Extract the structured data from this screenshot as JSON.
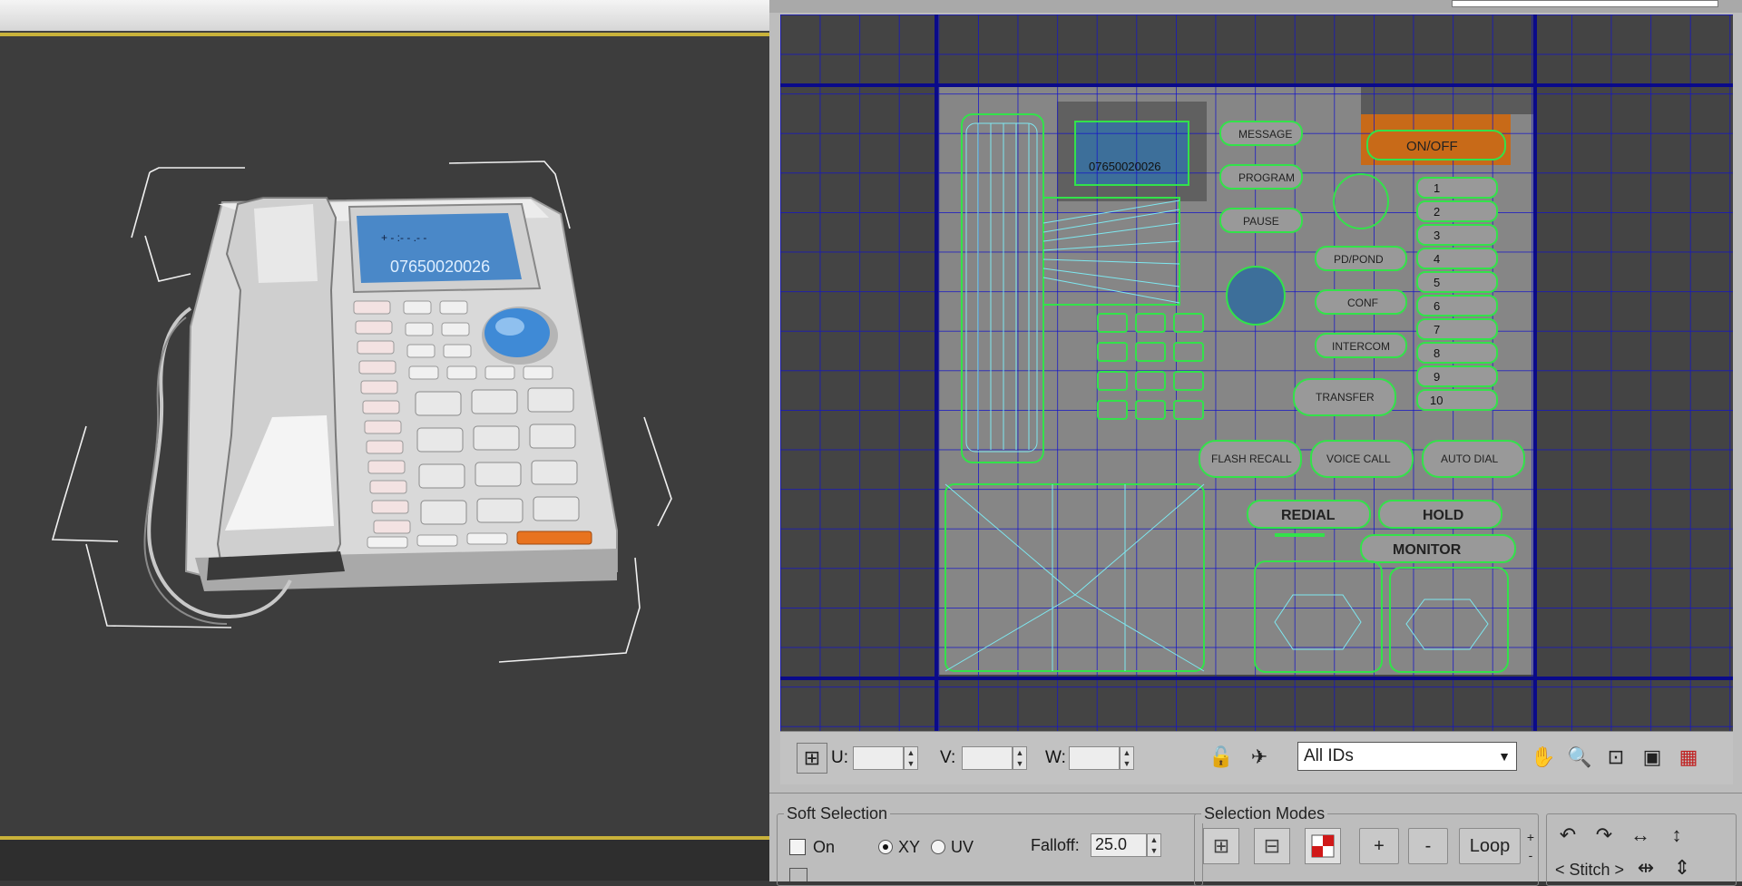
{
  "uv_editor": {
    "toolbar": {
      "u_label": "U:",
      "v_label": "V:",
      "w_label": "W:",
      "ids_select_value": "All IDs"
    },
    "texture_labels": {
      "message": "MESSAGE",
      "program": "PROGRAM",
      "pause": "PAUSE",
      "on_off": "ON/OFF",
      "pound": "PD/POND",
      "conf": "CONF",
      "intercom": "INTERCOM",
      "transfer": "TRANSFER",
      "flash_recall": "FLASH RECALL",
      "voice_call": "VOICE CALL",
      "auto_dial": "AUTO DIAL",
      "redial": "REDIAL",
      "hold": "HOLD",
      "monitor": "MONITOR",
      "lcd_number": "07650020026",
      "speed_dial_numbers": [
        "1",
        "2",
        "3",
        "4",
        "5",
        "6",
        "7",
        "8",
        "9",
        "10"
      ]
    }
  },
  "soft_selection": {
    "title": "Soft Selection",
    "on_label": "On",
    "xy_label": "XY",
    "uv_label": "UV",
    "falloff_label": "Falloff:",
    "falloff_value": "25.0"
  },
  "selection_modes": {
    "title": "Selection Modes",
    "plus_label": "+",
    "minus_label": "-",
    "loop_label": "Loop",
    "stitch_label": "< Stitch >"
  },
  "viewport": {
    "phone_lcd_number": "07650020026"
  }
}
